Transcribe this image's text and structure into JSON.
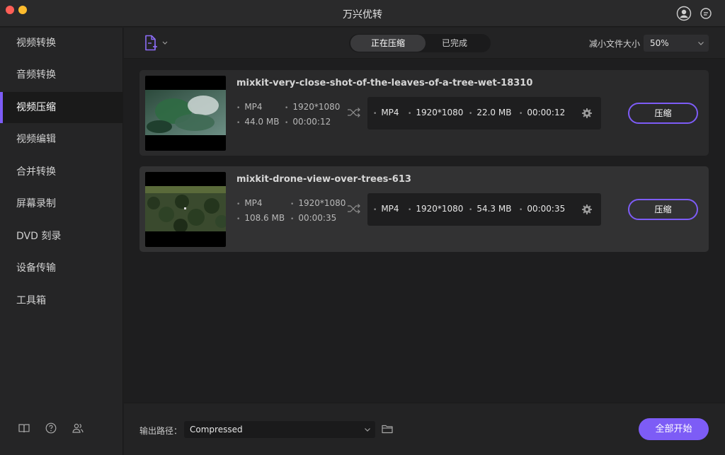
{
  "window": {
    "title": "万兴优转"
  },
  "colors": {
    "accent": "#7d5cf6",
    "bg": "#1e1e1f",
    "sidebar": "#252526"
  },
  "sidebar": {
    "items": [
      {
        "label": "视频转换"
      },
      {
        "label": "音频转换"
      },
      {
        "label": "视频压缩",
        "active": true
      },
      {
        "label": "视频编辑"
      },
      {
        "label": "合并转换"
      },
      {
        "label": "屏幕录制"
      },
      {
        "label": "DVD 刻录"
      },
      {
        "label": "设备传输"
      },
      {
        "label": "工具箱"
      }
    ],
    "footer_icons": [
      "book-icon",
      "help-icon",
      "users-icon"
    ]
  },
  "toolbar": {
    "tabs": [
      {
        "label": "正在压缩",
        "active": true
      },
      {
        "label": "已完成"
      }
    ],
    "reduce_label": "减小文件大小",
    "reduce_value": "50%"
  },
  "files": [
    {
      "name": "mixkit-very-close-shot-of-the-leaves-of-a-tree-wet-18310",
      "src_format": "MP4",
      "src_resolution": "1920*1080",
      "src_size": "44.0 MB",
      "src_duration": "00:00:12",
      "out_format": "MP4",
      "out_resolution": "1920*1080",
      "out_size": "22.0 MB",
      "out_duration": "00:00:12",
      "action_label": "压缩"
    },
    {
      "name": "mixkit-drone-view-over-trees-613",
      "src_format": "MP4",
      "src_resolution": "1920*1080",
      "src_size": "108.6 MB",
      "src_duration": "00:00:35",
      "out_format": "MP4",
      "out_resolution": "1920*1080",
      "out_size": "54.3 MB",
      "out_duration": "00:00:35",
      "action_label": "压缩"
    }
  ],
  "bottom": {
    "output_label": "输出路径：",
    "output_path": "Compressed",
    "start_all_label": "全部开始"
  }
}
